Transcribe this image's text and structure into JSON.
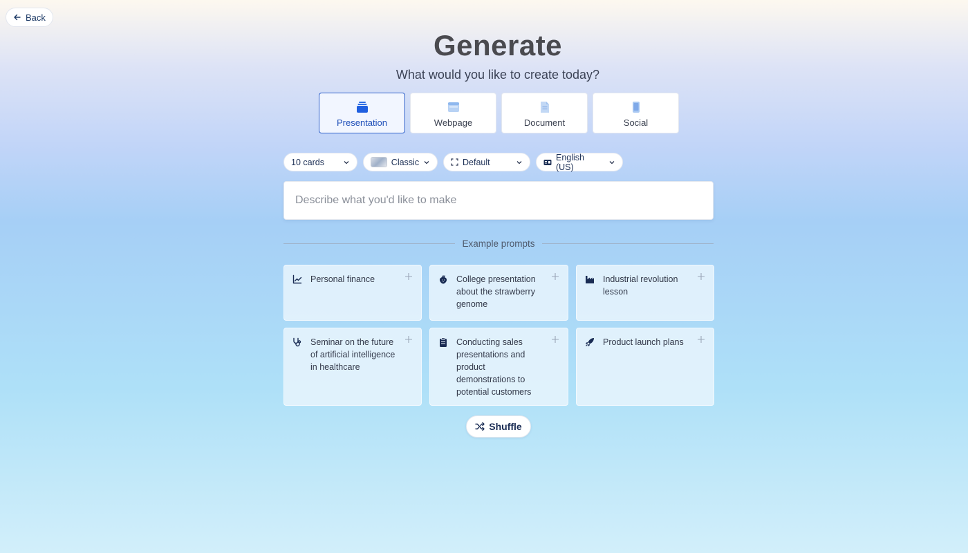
{
  "back": {
    "label": "Back",
    "icon": "arrow-left-icon"
  },
  "header": {
    "title": "Generate",
    "subtitle": "What would you like to create today?"
  },
  "types": [
    {
      "label": "Presentation",
      "icon": "stack-icon",
      "selected": true
    },
    {
      "label": "Webpage",
      "icon": "browser-window-icon",
      "selected": false
    },
    {
      "label": "Document",
      "icon": "document-icon",
      "selected": false
    },
    {
      "label": "Social",
      "icon": "phone-icon",
      "selected": false
    }
  ],
  "options": {
    "cards": "10 cards",
    "theme": "Classic",
    "format": "Default",
    "language": "English (US)"
  },
  "prompt": {
    "placeholder": "Describe what you'd like to make"
  },
  "examples": {
    "heading": "Example prompts",
    "items": [
      {
        "text": "Personal finance",
        "icon": "line-chart-icon"
      },
      {
        "text": "College presentation about the strawberry genome",
        "icon": "strawberry-icon"
      },
      {
        "text": "Industrial revolution lesson",
        "icon": "factory-icon"
      },
      {
        "text": "Seminar on the future of artificial intelligence in healthcare",
        "icon": "stethoscope-icon"
      },
      {
        "text": "Conducting sales presentations and product demonstrations to potential customers",
        "icon": "clipboard-icon"
      },
      {
        "text": "Product launch plans",
        "icon": "rocket-icon"
      }
    ]
  },
  "shuffle": {
    "label": "Shuffle",
    "icon": "shuffle-icon"
  },
  "colors": {
    "accent": "#2c5ec9",
    "navy": "#1a2c54"
  }
}
